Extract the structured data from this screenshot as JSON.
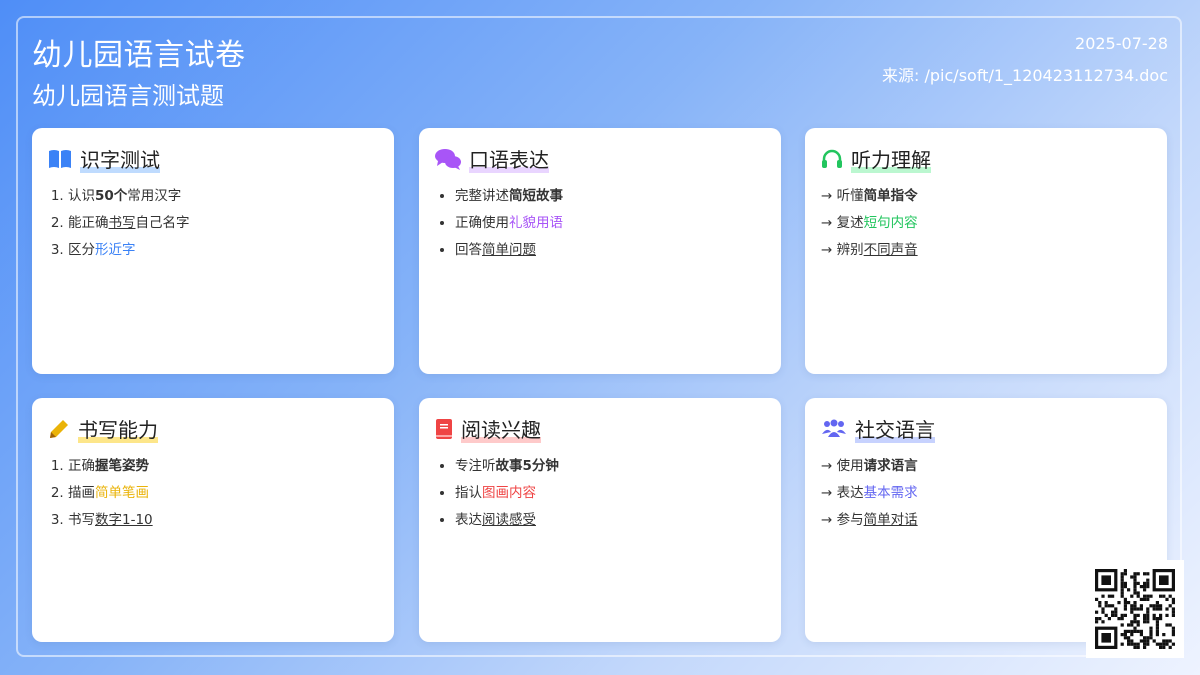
{
  "header": {
    "title": "幼儿园语言试卷",
    "subtitle": "幼儿园语言测试题",
    "date": "2025-07-28",
    "source": "来源: /pic/soft/1_120423112734.doc"
  },
  "cards": [
    {
      "title": "识字测试",
      "icon": "book-icon",
      "accent": "#3b82f6",
      "list_type": "ordered",
      "items": [
        {
          "pre": "认识",
          "em": "50个",
          "post": "常用汉字",
          "em_style": "bold"
        },
        {
          "pre": "能正确",
          "em": "书写",
          "post": "自己名字",
          "em_style": "underline"
        },
        {
          "pre": "区分",
          "em": "形近字",
          "post": "",
          "em_style": "color"
        }
      ]
    },
    {
      "title": "口语表达",
      "icon": "chat-bubbles-icon",
      "accent": "#a855f7",
      "list_type": "bullet",
      "items": [
        {
          "pre": "完整讲述",
          "em": "简短故事",
          "post": "",
          "em_style": "bold"
        },
        {
          "pre": "正确使用",
          "em": "礼貌用语",
          "post": "",
          "em_style": "color"
        },
        {
          "pre": "回答",
          "em": "简单问题",
          "post": "",
          "em_style": "underline"
        }
      ]
    },
    {
      "title": "听力理解",
      "icon": "headphones-icon",
      "accent": "#22c55e",
      "list_type": "arrow",
      "items": [
        {
          "pre": "听懂",
          "em": "简单指令",
          "post": "",
          "em_style": "bold"
        },
        {
          "pre": "复述",
          "em": "短句内容",
          "post": "",
          "em_style": "color"
        },
        {
          "pre": "辨别",
          "em": "不同声音",
          "post": "",
          "em_style": "underline"
        }
      ]
    },
    {
      "title": "书写能力",
      "icon": "pencil-icon",
      "accent": "#eab308",
      "list_type": "ordered",
      "items": [
        {
          "pre": "正确",
          "em": "握笔姿势",
          "post": "",
          "em_style": "bold"
        },
        {
          "pre": "描画",
          "em": "简单笔画",
          "post": "",
          "em_style": "color"
        },
        {
          "pre": "书写",
          "em": "数字1-10",
          "post": "",
          "em_style": "underline"
        }
      ]
    },
    {
      "title": "阅读兴趣",
      "icon": "red-book-icon",
      "accent": "#ef4444",
      "list_type": "bullet",
      "items": [
        {
          "pre": "专注听",
          "em": "故事5分钟",
          "post": "",
          "em_style": "bold"
        },
        {
          "pre": "指认",
          "em": "图画内容",
          "post": "",
          "em_style": "color"
        },
        {
          "pre": "表达",
          "em": "阅读感受",
          "post": "",
          "em_style": "underline"
        }
      ]
    },
    {
      "title": "社交语言",
      "icon": "users-icon",
      "accent": "#6366f1",
      "list_type": "arrow",
      "items": [
        {
          "pre": "使用",
          "em": "请求语言",
          "post": "",
          "em_style": "bold"
        },
        {
          "pre": "表达",
          "em": "基本需求",
          "post": "",
          "em_style": "color"
        },
        {
          "pre": "参与",
          "em": "简单对话",
          "post": "",
          "em_style": "underline"
        }
      ]
    }
  ]
}
